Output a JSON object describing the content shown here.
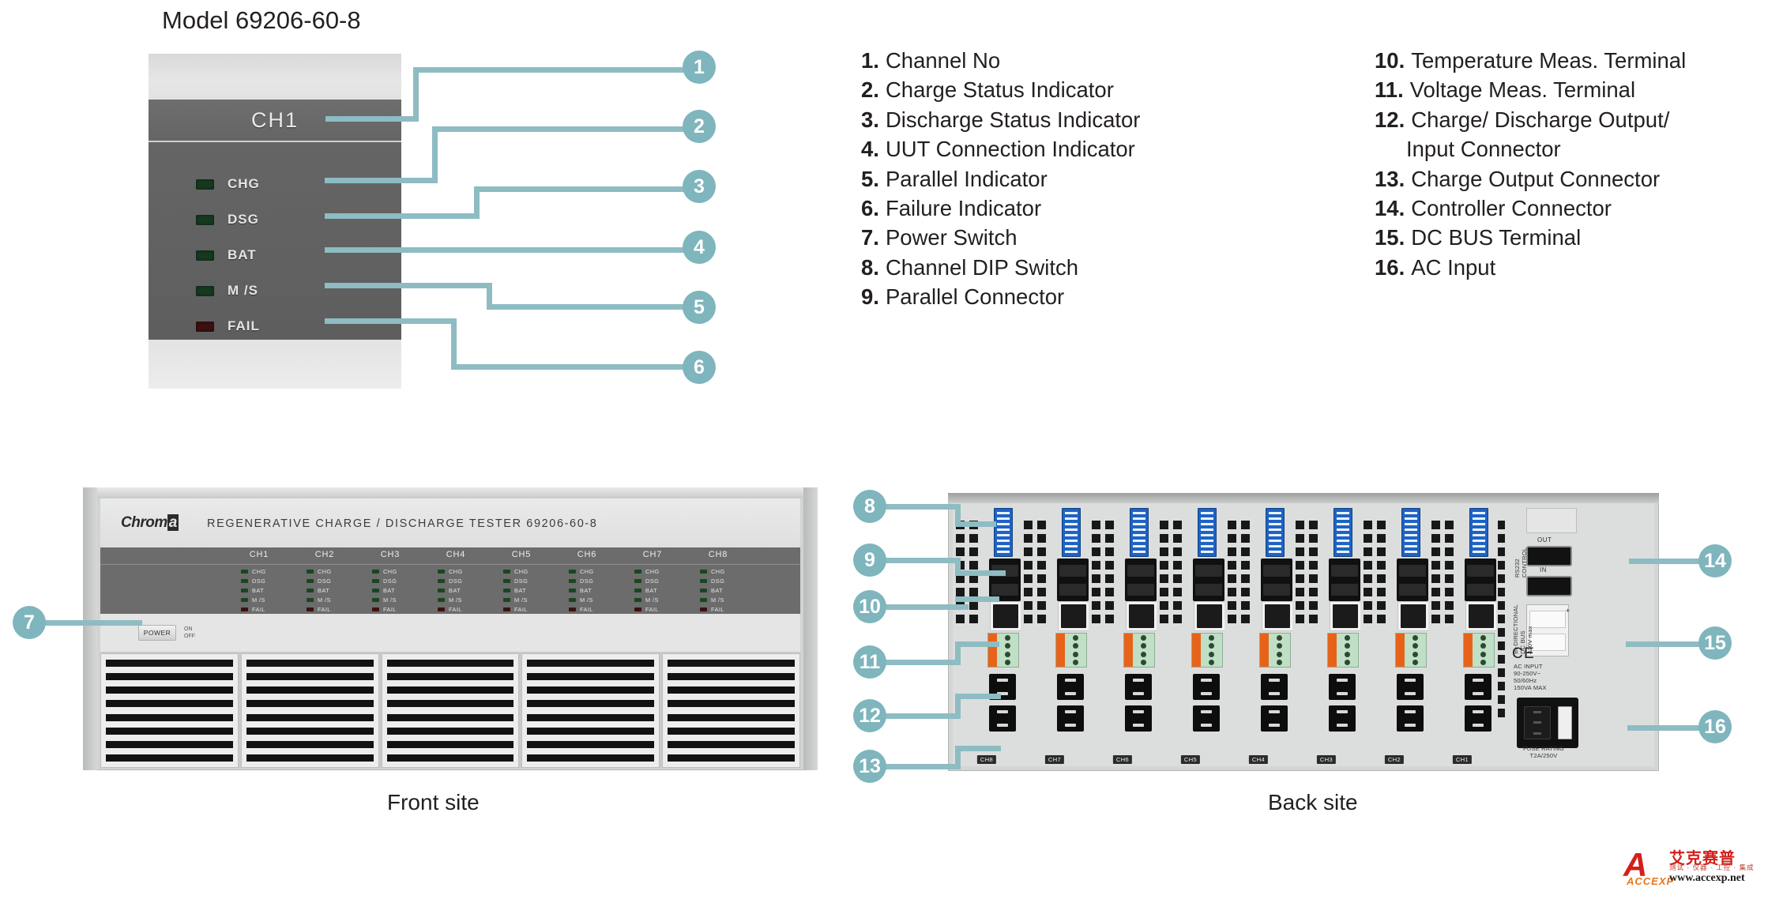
{
  "title": "Model 69206-60-8",
  "detail_photo": {
    "channel_label": "CH1",
    "leds": [
      {
        "label": "CHG",
        "color": "green"
      },
      {
        "label": "DSG",
        "color": "green"
      },
      {
        "label": "BAT",
        "color": "green"
      },
      {
        "label": "M /S",
        "color": "green"
      },
      {
        "label": "FAIL",
        "color": "red"
      }
    ]
  },
  "callouts": {
    "n1": "1",
    "n2": "2",
    "n3": "3",
    "n4": "4",
    "n5": "5",
    "n6": "6",
    "n7": "7",
    "n8": "8",
    "n9": "9",
    "n10": "10",
    "n11": "11",
    "n12": "12",
    "n13": "13",
    "n14": "14",
    "n15": "15",
    "n16": "16"
  },
  "legend": {
    "left": [
      {
        "num": "1.",
        "text": "Channel No"
      },
      {
        "num": "2.",
        "text": "Charge Status Indicator"
      },
      {
        "num": "3.",
        "text": "Discharge Status Indicator"
      },
      {
        "num": "4.",
        "text": "UUT Connection Indicator"
      },
      {
        "num": "5.",
        "text": "Parallel Indicator"
      },
      {
        "num": "6.",
        "text": "Failure Indicator"
      },
      {
        "num": "7.",
        "text": "Power Switch"
      },
      {
        "num": "8.",
        "text": "Channel DIP Switch"
      },
      {
        "num": "9.",
        "text": "Parallel Connector"
      }
    ],
    "right": [
      {
        "num": "10.",
        "text": "Temperature Meas. Terminal"
      },
      {
        "num": "11.",
        "text": "Voltage Meas. Terminal"
      },
      {
        "num": "12.",
        "text": "Charge/ Discharge Output/",
        "cont": "Input  Connector"
      },
      {
        "num": "13.",
        "text": "Charge Output Connector"
      },
      {
        "num": "14.",
        "text": "Controller Connector"
      },
      {
        "num": "15.",
        "text": "DC BUS Terminal"
      },
      {
        "num": "16.",
        "text": "AC Input"
      }
    ]
  },
  "front_unit": {
    "brand": "Chrom",
    "brand_tail": "a",
    "model_line": "REGENERATIVE CHARGE / DISCHARGE TESTER  69206-60-8",
    "channels": [
      "CH1",
      "CH2",
      "CH3",
      "CH4",
      "CH5",
      "CH6",
      "CH7",
      "CH8"
    ],
    "led_labels": [
      "CHG",
      "DSG",
      "BAT",
      "M /S",
      "FAIL"
    ],
    "power_label": "POWER",
    "power_on": "ON",
    "power_off": "OFF",
    "caption": "Front site"
  },
  "back_unit": {
    "channels": [
      "CH8",
      "CH7",
      "CH6",
      "CH5",
      "CH4",
      "CH3",
      "CH2",
      "CH1"
    ],
    "control_label": "RS232\nCONTROL",
    "control_out": "OUT",
    "control_in": "IN",
    "dcbus_label": "BI-DIRECTIONAL\nDC BUS\n420V max",
    "dcbus_plus": "+",
    "ac_input_spec": "AC INPUT\n90-250V~\n50/60Hz\n150VA MAX",
    "fuse_rating": "FUSE RATING\nT2A/250V",
    "ce_mark": "CE",
    "caption": "Back site"
  },
  "watermark": {
    "mark": "A",
    "sub": "ACCEXP",
    "cn_name": "艾克赛普",
    "cn_tag": "测试 · 仪器 · 工控 · 集成",
    "url": "www.accexp.net"
  },
  "colors": {
    "callout": "#7fb5bd",
    "leader": "#8ebcc3",
    "text": "#231f20",
    "led_green": "#16381f",
    "led_red": "#3a1010",
    "dip_blue": "#1e63c4",
    "terminal_green": "#bfe0c6",
    "terminal_orange": "#e8631a",
    "watermark_red": "#d3201b"
  }
}
